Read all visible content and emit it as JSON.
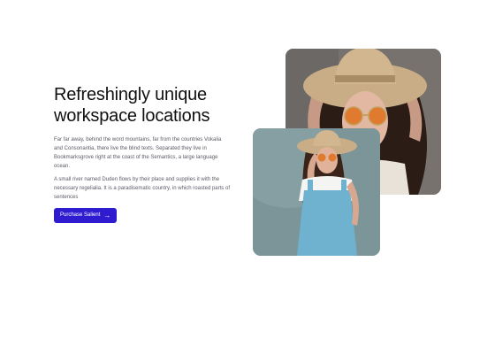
{
  "hero": {
    "headline_line1": "Refreshingly unique",
    "headline_line2": "workspace locations",
    "paragraph1": "Far far away, behind the word mountains, far from the countries Vokalia and Consonantia, there live the blind texts. Separated they live in Bookmarksgrove right at the coast of the Semantics, a large language ocean.",
    "paragraph2": "A small river named Duden flows by their place and supplies it with the necessary regelialia. It is a paradisematic country, in which roasted parts of sentences",
    "cta_label": "Purchase Salient",
    "cta_icon": "arrow-right-icon"
  },
  "images": {
    "top_photo": "woman-straw-hat-orange-sunglasses-photo",
    "bottom_photo": "woman-overalls-straw-hat-photo"
  },
  "colors": {
    "accent": "#2f1cd1",
    "text": "#101010",
    "body_text": "#5b5b66"
  }
}
